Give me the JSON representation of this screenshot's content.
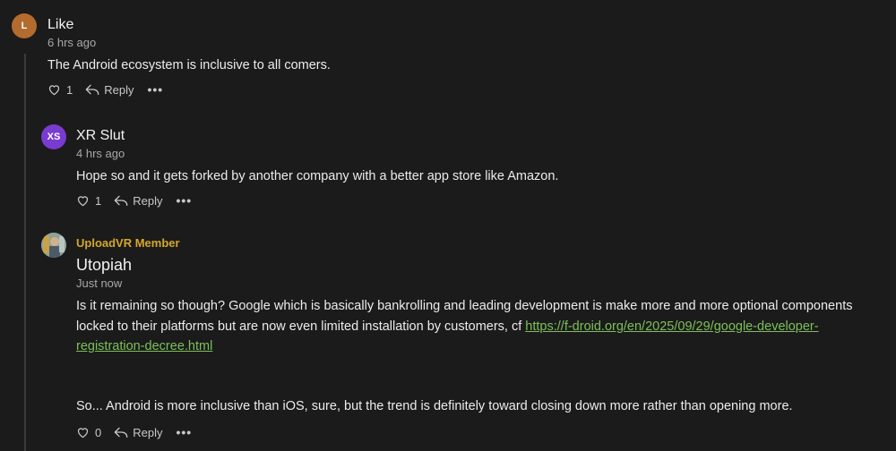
{
  "comments": [
    {
      "avatar_initials": "L",
      "avatar_color": "#b46b2e",
      "author": "Like",
      "time": "6 hrs ago",
      "body": "The Android ecosystem is inclusive to all comers.",
      "likes": "1",
      "reply_label": "Reply",
      "more_label": "•••"
    },
    {
      "avatar_initials": "XS",
      "avatar_color": "#7a3bd1",
      "author": "XR Slut",
      "time": "4 hrs ago",
      "body": "Hope so and it gets forked by another company with a better app store like Amazon.",
      "likes": "1",
      "reply_label": "Reply",
      "more_label": "•••"
    },
    {
      "badge": "UploadVR Member",
      "author": "Utopiah",
      "time": "Just now",
      "body_part1": "Is it remaining so though? Google which is basically bankrolling and leading development is make more and more optional components locked to their platforms but are now even limited installation by customers, cf ",
      "link_text": "https://f-droid.org/en/2025/09/29/google-developer-registration-decree.html",
      "body_part2": "So... Android is more inclusive than iOS, sure, but the trend is definitely toward closing down more rather than opening more.",
      "likes": "0",
      "reply_label": "Reply",
      "more_label": "•••"
    }
  ],
  "icons": {
    "like": "heart-outline-icon",
    "reply": "reply-arrow-icon",
    "more": "ellipsis-icon"
  },
  "colors": {
    "background": "#1b1b1b",
    "link": "#7cc05a",
    "badge": "#d4a72c"
  }
}
